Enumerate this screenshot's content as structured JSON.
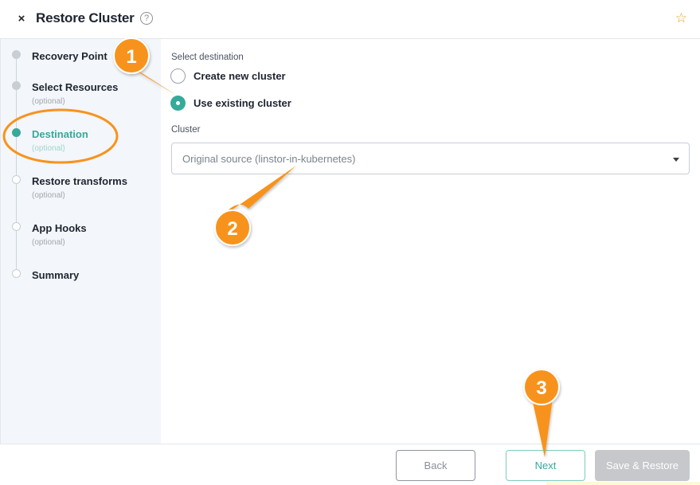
{
  "header": {
    "close_symbol": "×",
    "title": "Restore Cluster",
    "help_symbol": "?",
    "star_symbol": "☆"
  },
  "steps": [
    {
      "label": "Recovery Point",
      "sub": "",
      "state": "done"
    },
    {
      "label": "Select Resources",
      "sub": "(optional)",
      "state": "done"
    },
    {
      "label": "Destination",
      "sub": "(optional)",
      "state": "active"
    },
    {
      "label": "Restore transforms",
      "sub": "(optional)",
      "state": "todo"
    },
    {
      "label": "App Hooks",
      "sub": "(optional)",
      "state": "todo"
    },
    {
      "label": "Summary",
      "sub": "",
      "state": "todo"
    }
  ],
  "main": {
    "destination_label": "Select destination",
    "options": [
      {
        "label": "Create new cluster",
        "selected": false
      },
      {
        "label": "Use existing cluster",
        "selected": true
      }
    ],
    "cluster_label": "Cluster",
    "cluster_value": "Original source (linstor-in-kubernetes)"
  },
  "footer": {
    "back_label": "Back",
    "next_label": "Next",
    "save_label": "Save & Restore"
  },
  "annotations": {
    "markers": [
      "1",
      "2",
      "3"
    ],
    "color": "#f7931e",
    "text_color": "#ffffff"
  },
  "colors": {
    "accent": "#37a99a",
    "star": "#e8a317",
    "disabled": "#c6c8cc"
  }
}
